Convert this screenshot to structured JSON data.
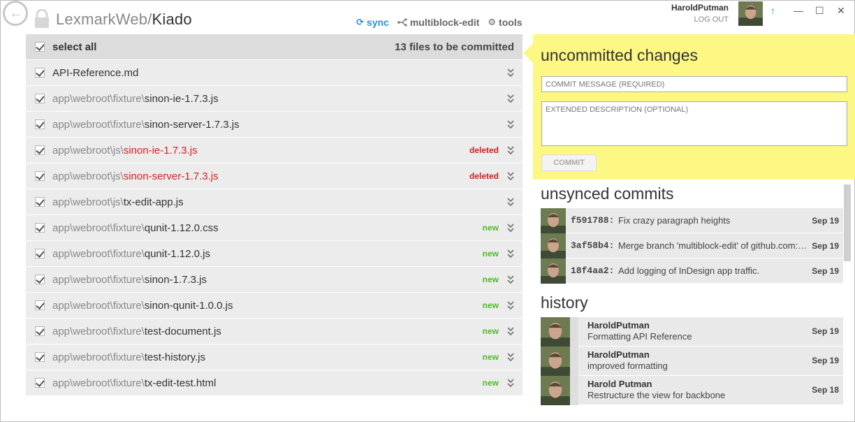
{
  "header": {
    "repo_owner": "LexmarkWeb",
    "separator": "/",
    "repo_name": "Kiado",
    "toolbar": {
      "sync": "sync",
      "multiblock": "multiblock-edit",
      "tools": "tools"
    },
    "user": {
      "name": "HaroldPutman",
      "logout": "LOG OUT"
    }
  },
  "file_list": {
    "select_all": "select all",
    "commit_count": "13 files to be committed",
    "files": [
      {
        "dir": "",
        "name": "API-Reference.md",
        "status": ""
      },
      {
        "dir": "app\\webroot\\fixture\\",
        "name": "sinon-ie-1.7.3.js",
        "status": ""
      },
      {
        "dir": "app\\webroot\\fixture\\",
        "name": "sinon-server-1.7.3.js",
        "status": ""
      },
      {
        "dir": "app\\webroot\\js\\",
        "name": "sinon-ie-1.7.3.js",
        "status": "deleted"
      },
      {
        "dir": "app\\webroot\\js\\",
        "name": "sinon-server-1.7.3.js",
        "status": "deleted"
      },
      {
        "dir": "app\\webroot\\js\\",
        "name": "tx-edit-app.js",
        "status": ""
      },
      {
        "dir": "app\\webroot\\fixture\\",
        "name": "qunit-1.12.0.css",
        "status": "new"
      },
      {
        "dir": "app\\webroot\\fixture\\",
        "name": "qunit-1.12.0.js",
        "status": "new"
      },
      {
        "dir": "app\\webroot\\fixture\\",
        "name": "sinon-1.7.3.js",
        "status": "new"
      },
      {
        "dir": "app\\webroot\\fixture\\",
        "name": "sinon-qunit-1.0.0.js",
        "status": "new"
      },
      {
        "dir": "app\\webroot\\fixture\\",
        "name": "test-document.js",
        "status": "new"
      },
      {
        "dir": "app\\webroot\\fixture\\",
        "name": "test-history.js",
        "status": "new"
      },
      {
        "dir": "app\\webroot\\fixture\\",
        "name": "tx-edit-test.html",
        "status": "new"
      }
    ]
  },
  "commit_panel": {
    "heading": "uncommitted changes",
    "message_placeholder": "COMMIT MESSAGE (REQUIRED)",
    "description_placeholder": "EXTENDED DESCRIPTION (OPTIONAL)",
    "commit_button": "COMMIT"
  },
  "unsynced": {
    "title": "unsynced commits",
    "commits": [
      {
        "sha": "f591788:",
        "message": "Fix crazy paragraph heights",
        "date": "Sep 19"
      },
      {
        "sha": "3af58b4:",
        "message": "Merge branch 'multiblock-edit' of github.com:LexmarkWeb/Kiado",
        "date": "Sep 19"
      },
      {
        "sha": "18f4aa2:",
        "message": "Add logging of InDesign app traffic.",
        "date": "Sep 19"
      }
    ]
  },
  "history": {
    "title": "history",
    "entries": [
      {
        "author": "HaroldPutman",
        "message": "Formatting API Reference",
        "date": "Sep 19"
      },
      {
        "author": "HaroldPutman",
        "message": "improved formatting",
        "date": "Sep 19"
      },
      {
        "author": "Harold Putman",
        "message": "Restructure the view for backbone",
        "date": "Sep 18"
      }
    ]
  },
  "colors": {
    "accent": "#2a8fd6",
    "commit_panel_bg": "#fdf784",
    "new": "#4cba2a",
    "deleted": "#c82020"
  }
}
